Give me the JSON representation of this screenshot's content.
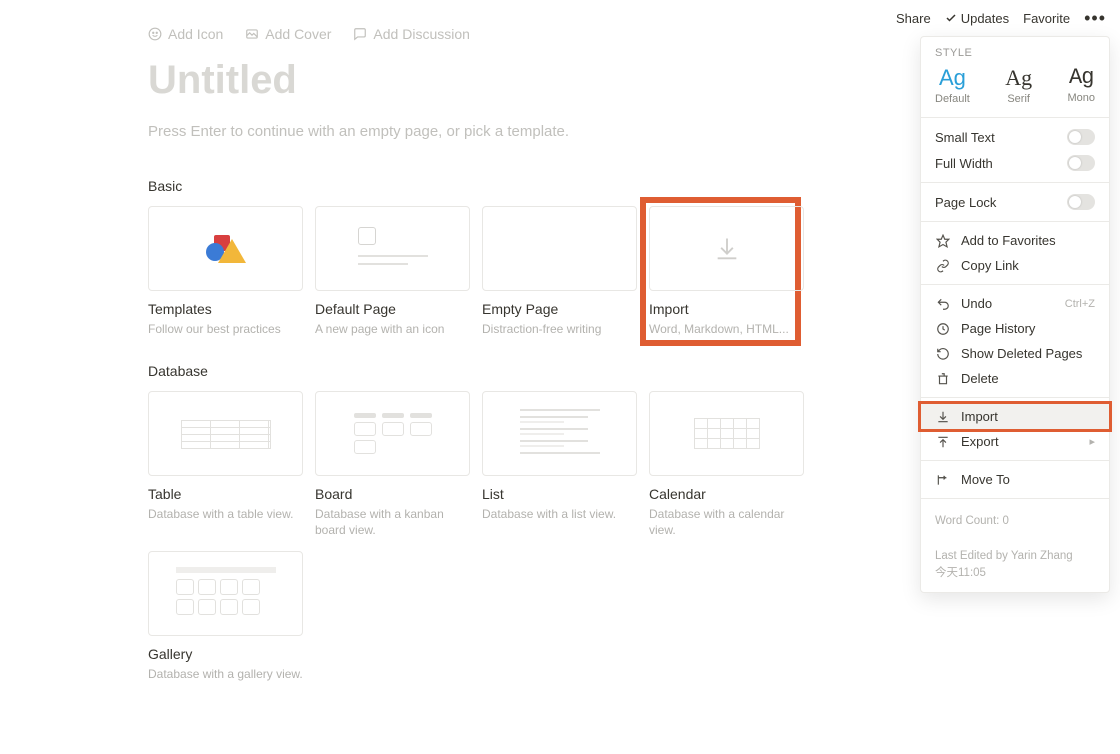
{
  "topbar": {
    "share": "Share",
    "updates": "Updates",
    "favorite": "Favorite"
  },
  "pageActions": {
    "addIcon": "Add Icon",
    "addCover": "Add Cover",
    "addDiscussion": "Add Discussion"
  },
  "title": "Untitled",
  "hint": "Press Enter to continue with an empty page, or pick a template.",
  "sections": {
    "basic": "Basic",
    "database": "Database"
  },
  "basicCards": [
    {
      "title": "Templates",
      "sub": "Follow our best practices"
    },
    {
      "title": "Default Page",
      "sub": "A new page with an icon"
    },
    {
      "title": "Empty Page",
      "sub": "Distraction-free writing"
    },
    {
      "title": "Import",
      "sub": "Word, Markdown, HTML..."
    }
  ],
  "dbCards": [
    {
      "title": "Table",
      "sub": "Database with a table view."
    },
    {
      "title": "Board",
      "sub": "Database with a kanban board view."
    },
    {
      "title": "List",
      "sub": "Database with a list view."
    },
    {
      "title": "Calendar",
      "sub": "Database with a calendar view."
    },
    {
      "title": "Gallery",
      "sub": "Database with a gallery view."
    }
  ],
  "panel": {
    "styleHeader": "STYLE",
    "styles": {
      "default": "Default",
      "serif": "Serif",
      "mono": "Mono",
      "ag": "Ag"
    },
    "smallText": "Small Text",
    "fullWidth": "Full Width",
    "pageLock": "Page Lock",
    "addFav": "Add to Favorites",
    "copyLink": "Copy Link",
    "undo": "Undo",
    "undoShortcut": "Ctrl+Z",
    "history": "Page History",
    "showDeleted": "Show Deleted Pages",
    "delete": "Delete",
    "import": "Import",
    "export": "Export",
    "moveTo": "Move To",
    "wordCount": "Word Count: 0",
    "lastEdited": "Last Edited by Yarin Zhang",
    "lastEditedTime": "今天11:05"
  }
}
